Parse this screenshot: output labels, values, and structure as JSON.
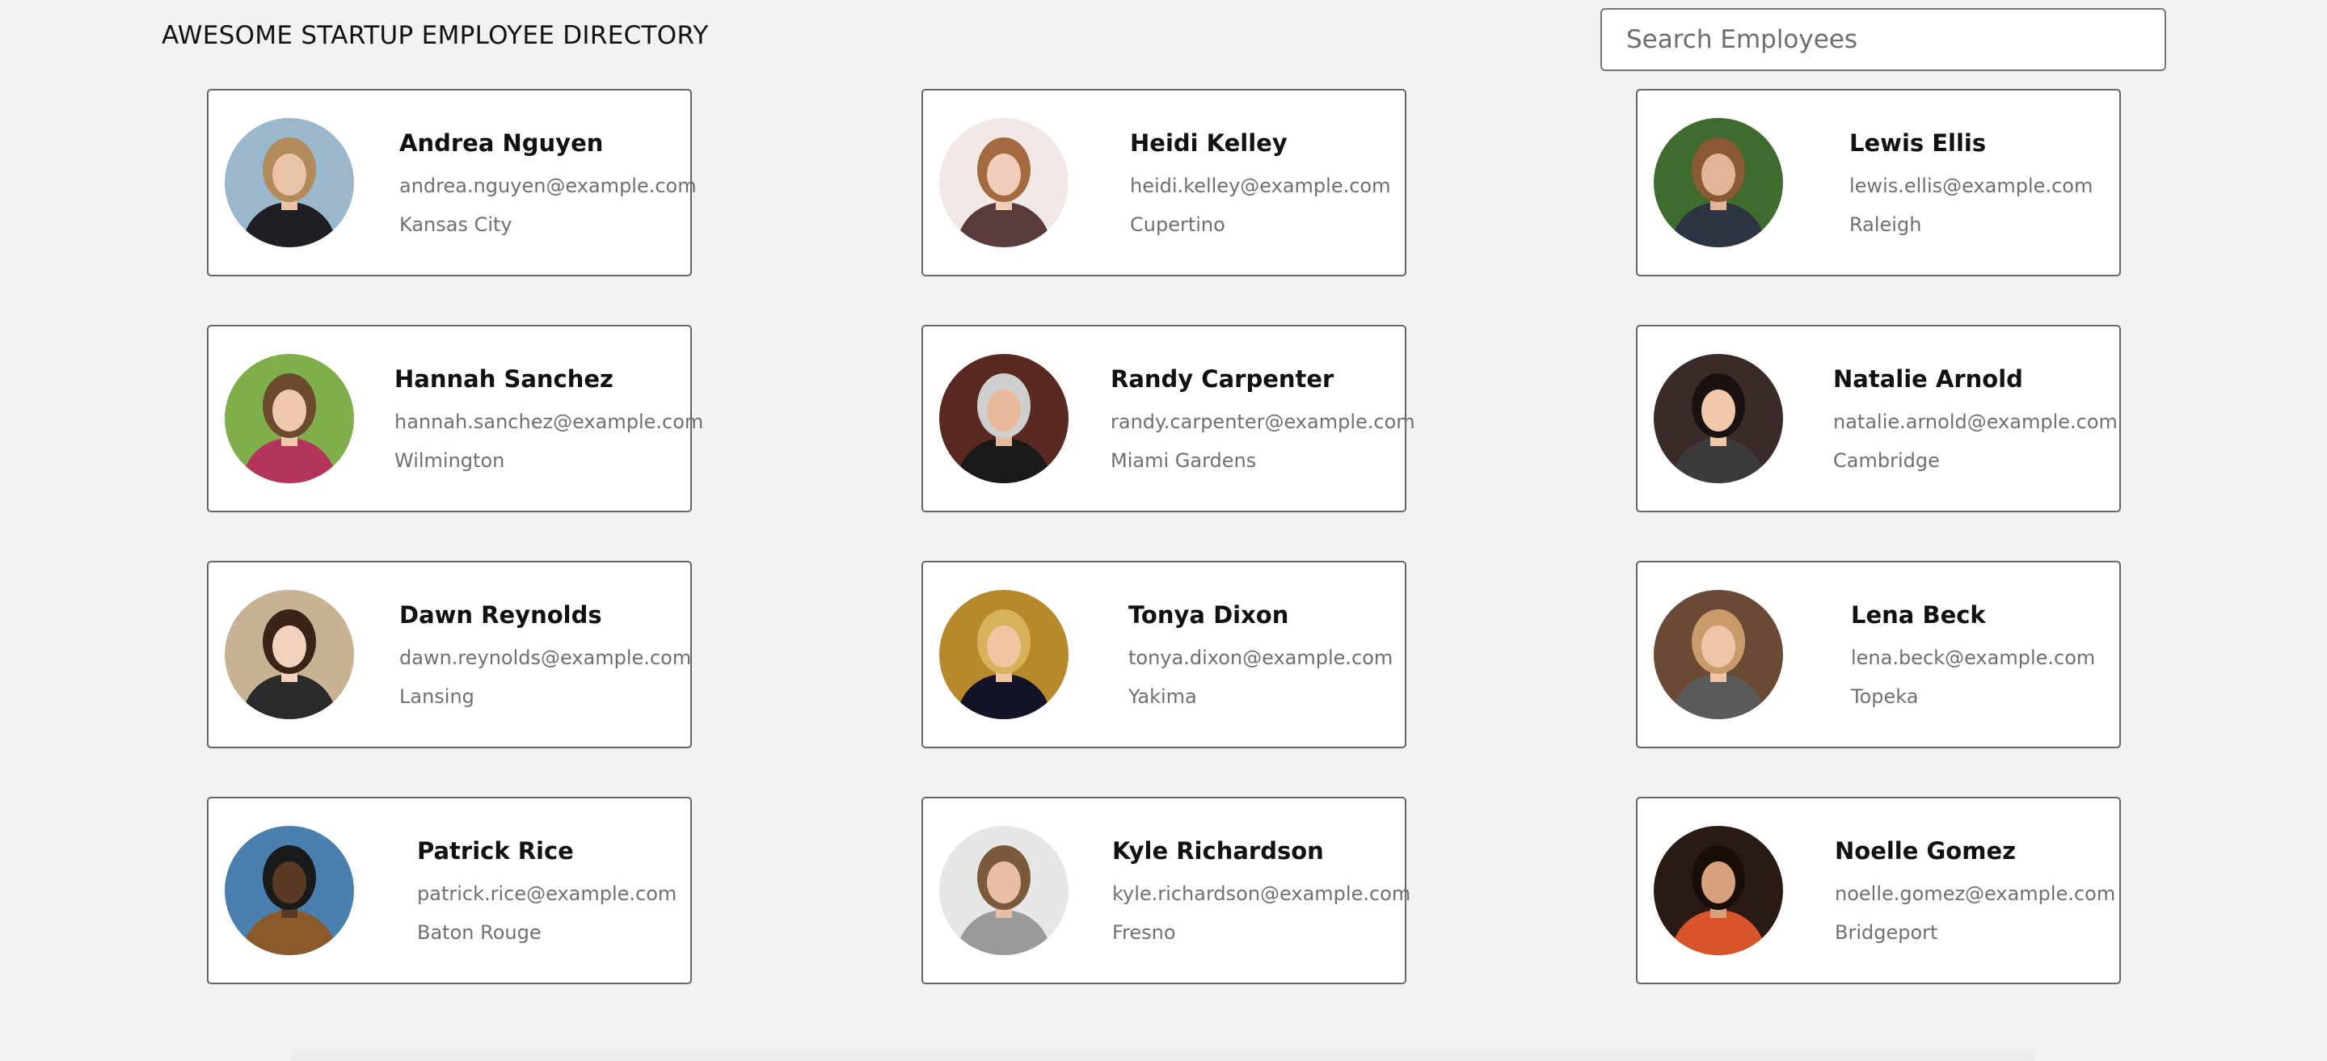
{
  "header": {
    "title": "AWESOME STARTUP EMPLOYEE DIRECTORY",
    "search_placeholder": "Search Employees"
  },
  "employees": [
    {
      "name": "Andrea Nguyen",
      "email": "andrea.nguyen@example.com",
      "city": "Kansas City",
      "photo": {
        "bg": "#9bb7cc",
        "skin": "#e8c3a6",
        "hair": "#b38a5a",
        "shirt": "#1e1e24"
      }
    },
    {
      "name": "Heidi Kelley",
      "email": "heidi.kelley@example.com",
      "city": "Cupertino",
      "photo": {
        "bg": "#f2e8e6",
        "skin": "#f0cdb8",
        "hair": "#a36a3f",
        "shirt": "#5a3a3a"
      }
    },
    {
      "name": "Lewis Ellis",
      "email": "lewis.ellis@example.com",
      "city": "Raleigh",
      "photo": {
        "bg": "#3f6b2f",
        "skin": "#e2b498",
        "hair": "#8a5a34",
        "shirt": "#2c3442"
      }
    },
    {
      "name": "Hannah Sanchez",
      "email": "hannah.sanchez@example.com",
      "city": "Wilmington",
      "photo": {
        "bg": "#7fae4a",
        "skin": "#f0c9ad",
        "hair": "#6b4a2e",
        "shirt": "#b5345c"
      }
    },
    {
      "name": "Randy Carpenter",
      "email": "randy.carpenter@example.com",
      "city": "Miami Gardens",
      "photo": {
        "bg": "#5a2a22",
        "skin": "#e8b89a",
        "hair": "#cfcfcf",
        "shirt": "#1a1a1a"
      }
    },
    {
      "name": "Natalie Arnold",
      "email": "natalie.arnold@example.com",
      "city": "Cambridge",
      "photo": {
        "bg": "#3a2a28",
        "skin": "#f2c9a8",
        "hair": "#1a1210",
        "shirt": "#3b3b3b"
      }
    },
    {
      "name": "Dawn Reynolds",
      "email": "dawn.reynolds@example.com",
      "city": "Lansing",
      "photo": {
        "bg": "#c7b394",
        "skin": "#f3d2bd",
        "hair": "#3a2418",
        "shirt": "#2a2a2a"
      }
    },
    {
      "name": "Tonya Dixon",
      "email": "tonya.dixon@example.com",
      "city": "Yakima",
      "photo": {
        "bg": "#b8892a",
        "skin": "#f0c6a2",
        "hair": "#d8b25a",
        "shirt": "#141428"
      }
    },
    {
      "name": "Lena Beck",
      "email": "lena.beck@example.com",
      "city": "Topeka",
      "photo": {
        "bg": "#6a4a34",
        "skin": "#efc5a8",
        "hair": "#c99a6a",
        "shirt": "#5a5a5a"
      }
    },
    {
      "name": "Patrick Rice",
      "email": "patrick.rice@example.com",
      "city": "Baton Rouge",
      "photo": {
        "bg": "#4a80b0",
        "skin": "#5a3a24",
        "hair": "#1a1a1a",
        "shirt": "#8a5a2a"
      }
    },
    {
      "name": "Kyle Richardson",
      "email": "kyle.richardson@example.com",
      "city": "Fresno",
      "photo": {
        "bg": "#e6e6e6",
        "skin": "#e8bfa2",
        "hair": "#7a5a3a",
        "shirt": "#9a9a9a"
      }
    },
    {
      "name": "Noelle Gomez",
      "email": "noelle.gomez@example.com",
      "city": "Bridgeport",
      "photo": {
        "bg": "#2a1a14",
        "skin": "#d9a27e",
        "hair": "#1a0e0a",
        "shirt": "#d8542a"
      }
    }
  ]
}
